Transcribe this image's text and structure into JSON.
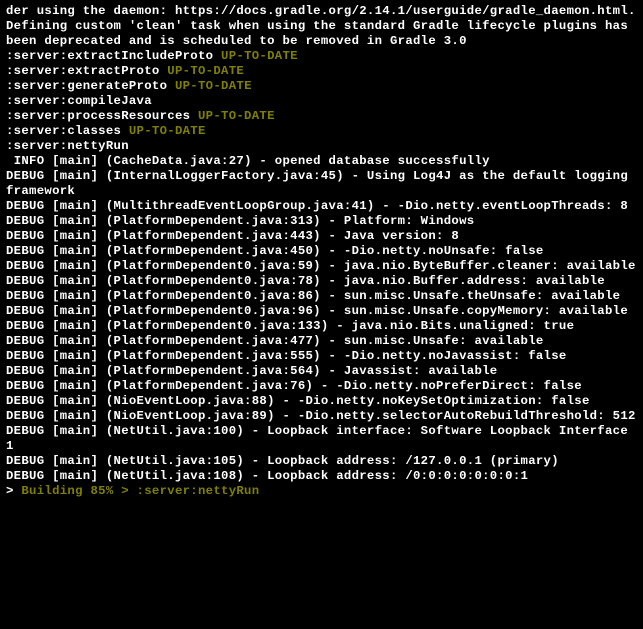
{
  "lines": [
    {
      "segs": [
        {
          "t": "der using the daemon: https://docs.gradle.org/2.14.1/userguide/gradle_daemon.html."
        }
      ]
    },
    {
      "segs": [
        {
          "t": "Defining custom 'clean' task when using the standard Gradle lifecycle plugins has been deprecated and is scheduled to be removed in Gradle 3.0"
        }
      ]
    },
    {
      "segs": [
        {
          "t": ":server:extractIncludeProto ",
          "c": "white"
        },
        {
          "t": "UP-TO-DATE",
          "c": "olive"
        }
      ]
    },
    {
      "segs": [
        {
          "t": ":server:extractProto ",
          "c": "white"
        },
        {
          "t": "UP-TO-DATE",
          "c": "olive"
        }
      ]
    },
    {
      "segs": [
        {
          "t": ":server:generateProto ",
          "c": "white"
        },
        {
          "t": "UP-TO-DATE",
          "c": "olive"
        }
      ]
    },
    {
      "segs": [
        {
          "t": ":server:compileJava"
        }
      ]
    },
    {
      "segs": [
        {
          "t": ":server:processResources ",
          "c": "white"
        },
        {
          "t": "UP-TO-DATE",
          "c": "olive"
        }
      ]
    },
    {
      "segs": [
        {
          "t": ":server:classes ",
          "c": "white"
        },
        {
          "t": "UP-TO-DATE",
          "c": "olive"
        }
      ]
    },
    {
      "segs": [
        {
          "t": ":server:nettyRun"
        }
      ]
    },
    {
      "segs": [
        {
          "t": " INFO [main] (CacheData.java:27) - opened database successfully"
        }
      ]
    },
    {
      "segs": [
        {
          "t": "DEBUG [main] (InternalLoggerFactory.java:45) - Using Log4J as the default logging framework"
        }
      ]
    },
    {
      "segs": [
        {
          "t": "DEBUG [main] (MultithreadEventLoopGroup.java:41) - -Dio.netty.eventLoopThreads: 8"
        }
      ]
    },
    {
      "segs": [
        {
          "t": "DEBUG [main] (PlatformDependent.java:313) - Platform: Windows"
        }
      ]
    },
    {
      "segs": [
        {
          "t": "DEBUG [main] (PlatformDependent.java:443) - Java version: 8"
        }
      ]
    },
    {
      "segs": [
        {
          "t": "DEBUG [main] (PlatformDependent.java:450) - -Dio.netty.noUnsafe: false"
        }
      ]
    },
    {
      "segs": [
        {
          "t": "DEBUG [main] (PlatformDependent0.java:59) - java.nio.ByteBuffer.cleaner: available"
        }
      ]
    },
    {
      "segs": [
        {
          "t": "DEBUG [main] (PlatformDependent0.java:78) - java.nio.Buffer.address: available"
        }
      ]
    },
    {
      "segs": [
        {
          "t": "DEBUG [main] (PlatformDependent0.java:86) - sun.misc.Unsafe.theUnsafe: available"
        }
      ]
    },
    {
      "segs": [
        {
          "t": ""
        }
      ]
    },
    {
      "segs": [
        {
          "t": "DEBUG [main] (PlatformDependent0.java:96) - sun.misc.Unsafe.copyMemory: available"
        }
      ]
    },
    {
      "segs": [
        {
          "t": "DEBUG [main] (PlatformDependent0.java:133) - java.nio.Bits.unaligned: true"
        }
      ]
    },
    {
      "segs": [
        {
          "t": "DEBUG [main] (PlatformDependent.java:477) - sun.misc.Unsafe: available"
        }
      ]
    },
    {
      "segs": [
        {
          "t": "DEBUG [main] (PlatformDependent.java:555) - -Dio.netty.noJavassist: false"
        }
      ]
    },
    {
      "segs": [
        {
          "t": "DEBUG [main] (PlatformDependent.java:564) - Javassist: available"
        }
      ]
    },
    {
      "segs": [
        {
          "t": "DEBUG [main] (PlatformDependent.java:76) - -Dio.netty.noPreferDirect: false"
        }
      ]
    },
    {
      "segs": [
        {
          "t": "DEBUG [main] (NioEventLoop.java:88) - -Dio.netty.noKeySetOptimization: false"
        }
      ]
    },
    {
      "segs": [
        {
          "t": "DEBUG [main] (NioEventLoop.java:89) - -Dio.netty.selectorAutoRebuildThreshold: 512"
        }
      ]
    },
    {
      "segs": [
        {
          "t": "DEBUG [main] (NetUtil.java:100) - Loopback interface: Software Loopback Interface 1"
        }
      ]
    },
    {
      "segs": [
        {
          "t": "DEBUG [main] (NetUtil.java:105) - Loopback address: /127.0.0.1 (primary)"
        }
      ]
    },
    {
      "segs": [
        {
          "t": "DEBUG [main] (NetUtil.java:108) - Loopback address: /0:0:0:0:0:0:0:1"
        }
      ]
    },
    {
      "segs": [
        {
          "t": "> ",
          "c": "white"
        },
        {
          "t": "Building 85% > :server:nettyRun",
          "c": "olive"
        }
      ]
    }
  ]
}
